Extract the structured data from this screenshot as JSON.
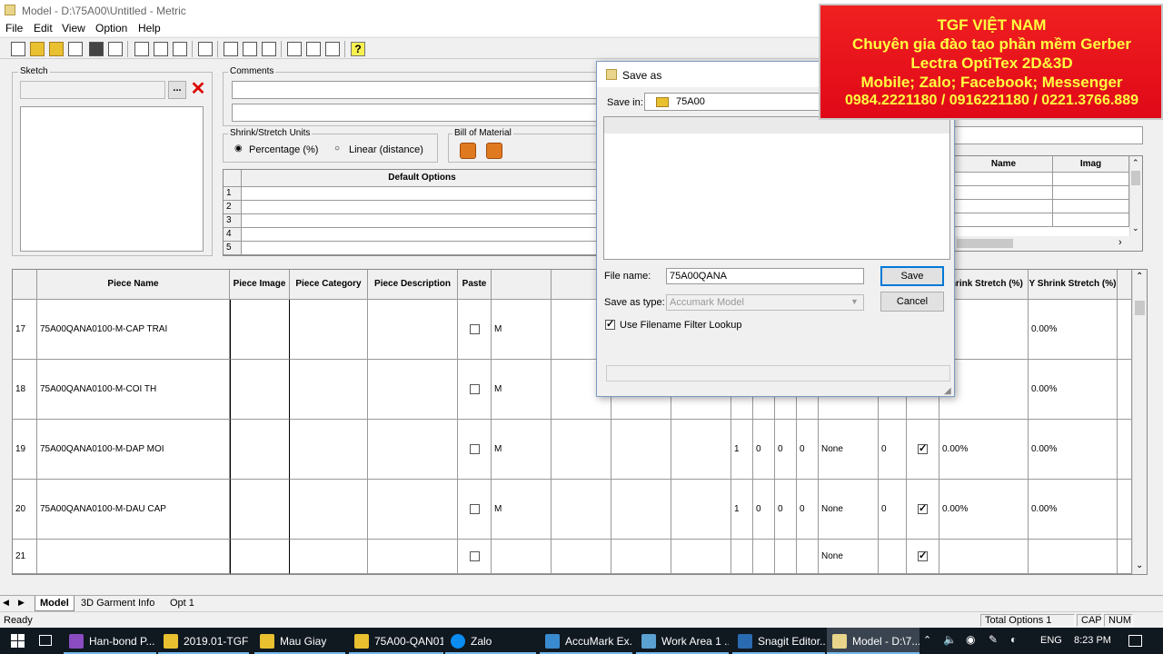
{
  "window": {
    "title": "Model - D:\\75A00\\Untitled - Metric"
  },
  "menu": [
    "File",
    "Edit",
    "View",
    "Option",
    "Help"
  ],
  "sketch": {
    "label": "Sketch",
    "browse": "..."
  },
  "comments": {
    "label": "Comments"
  },
  "units": {
    "label": "Shrink/Stretch Units",
    "opt1": "Percentage (%)",
    "opt2": "Linear (distance)"
  },
  "bom": {
    "label": "Bill of Material"
  },
  "default_options": {
    "header": "Default Options",
    "rows": [
      "1",
      "2",
      "3",
      "4",
      "5"
    ]
  },
  "right_table": {
    "col_name": "Name",
    "col_image": "Imag"
  },
  "pieces": {
    "headers": [
      "Piece Name",
      "Piece Image",
      "Piece Category",
      "Piece Description",
      "Paste",
      "Shrink Stretch (%)",
      "Y Shrink Stretch (%)"
    ],
    "rows": [
      {
        "num": "17",
        "name": "75A00QANA0100-M-CAP TRAI",
        "size": "M",
        "checked": false,
        "qty": "",
        "c1": "",
        "c2": "",
        "c3": "",
        "flip": "",
        "z": "",
        "shrink": "0%",
        "yshrink": "0.00%"
      },
      {
        "num": "18",
        "name": "75A00QANA0100-M-COI TH",
        "size": "M",
        "checked": false,
        "qty": "",
        "c1": "",
        "c2": "",
        "c3": "",
        "flip": "",
        "z": "",
        "shrink": "0%",
        "yshrink": "0.00%"
      },
      {
        "num": "19",
        "name": "75A00QANA0100-M-DAP MOI",
        "size": "M",
        "checked": true,
        "qty": "1",
        "c1": "0",
        "c2": "0",
        "c3": "0",
        "flip": "None",
        "z": "0",
        "shrink": "0.00%",
        "yshrink": "0.00%"
      },
      {
        "num": "20",
        "name": "75A00QANA0100-M-DAU CAP",
        "size": "M",
        "checked": true,
        "qty": "1",
        "c1": "0",
        "c2": "0",
        "c3": "0",
        "flip": "None",
        "z": "0",
        "shrink": "0.00%",
        "yshrink": "0.00%"
      },
      {
        "num": "21",
        "name": "",
        "size": "",
        "checked": true,
        "qty": "",
        "c1": "",
        "c2": "",
        "c3": "",
        "flip": "None",
        "z": "",
        "shrink": "",
        "yshrink": ""
      }
    ]
  },
  "tabs": [
    "Model",
    "3D Garment Info",
    "Opt 1"
  ],
  "status": {
    "ready": "Ready",
    "total": "Total Options 1",
    "cap": "CAP",
    "num": "NUM"
  },
  "dialog": {
    "title": "Save as",
    "save_in_label": "Save in:",
    "save_in_value": "75A00",
    "file_name_label": "File name:",
    "file_name_value": "75A00QANA",
    "save_type_label": "Save as type:",
    "save_type_value": "Accumark Model",
    "filter_label": "Use Filename Filter Lookup",
    "save_button": "Save",
    "cancel_button": "Cancel"
  },
  "banner": {
    "line1": "TGF VIỆT NAM",
    "line2": "Chuyên gia đào tạo phần mềm Gerber",
    "line3": "Lectra OptiTex 2D&3D",
    "line4": "Mobile; Zalo; Facebook; Messenger",
    "line5": "0984.2221180 / 0916221180 / 0221.3766.889",
    "color_bg": "#e8101c",
    "color_text": "#ffff40"
  },
  "taskbar": {
    "items": [
      "Han-bond P...",
      "2019.01-TGF",
      "Mau Giay",
      "75A00-QAN01",
      "Zalo",
      "AccuMark Ex...",
      "Work Area 1 ...",
      "Snagit Editor...",
      "Model - D:\\7..."
    ],
    "lang": "ENG",
    "time": "8:23 PM"
  }
}
